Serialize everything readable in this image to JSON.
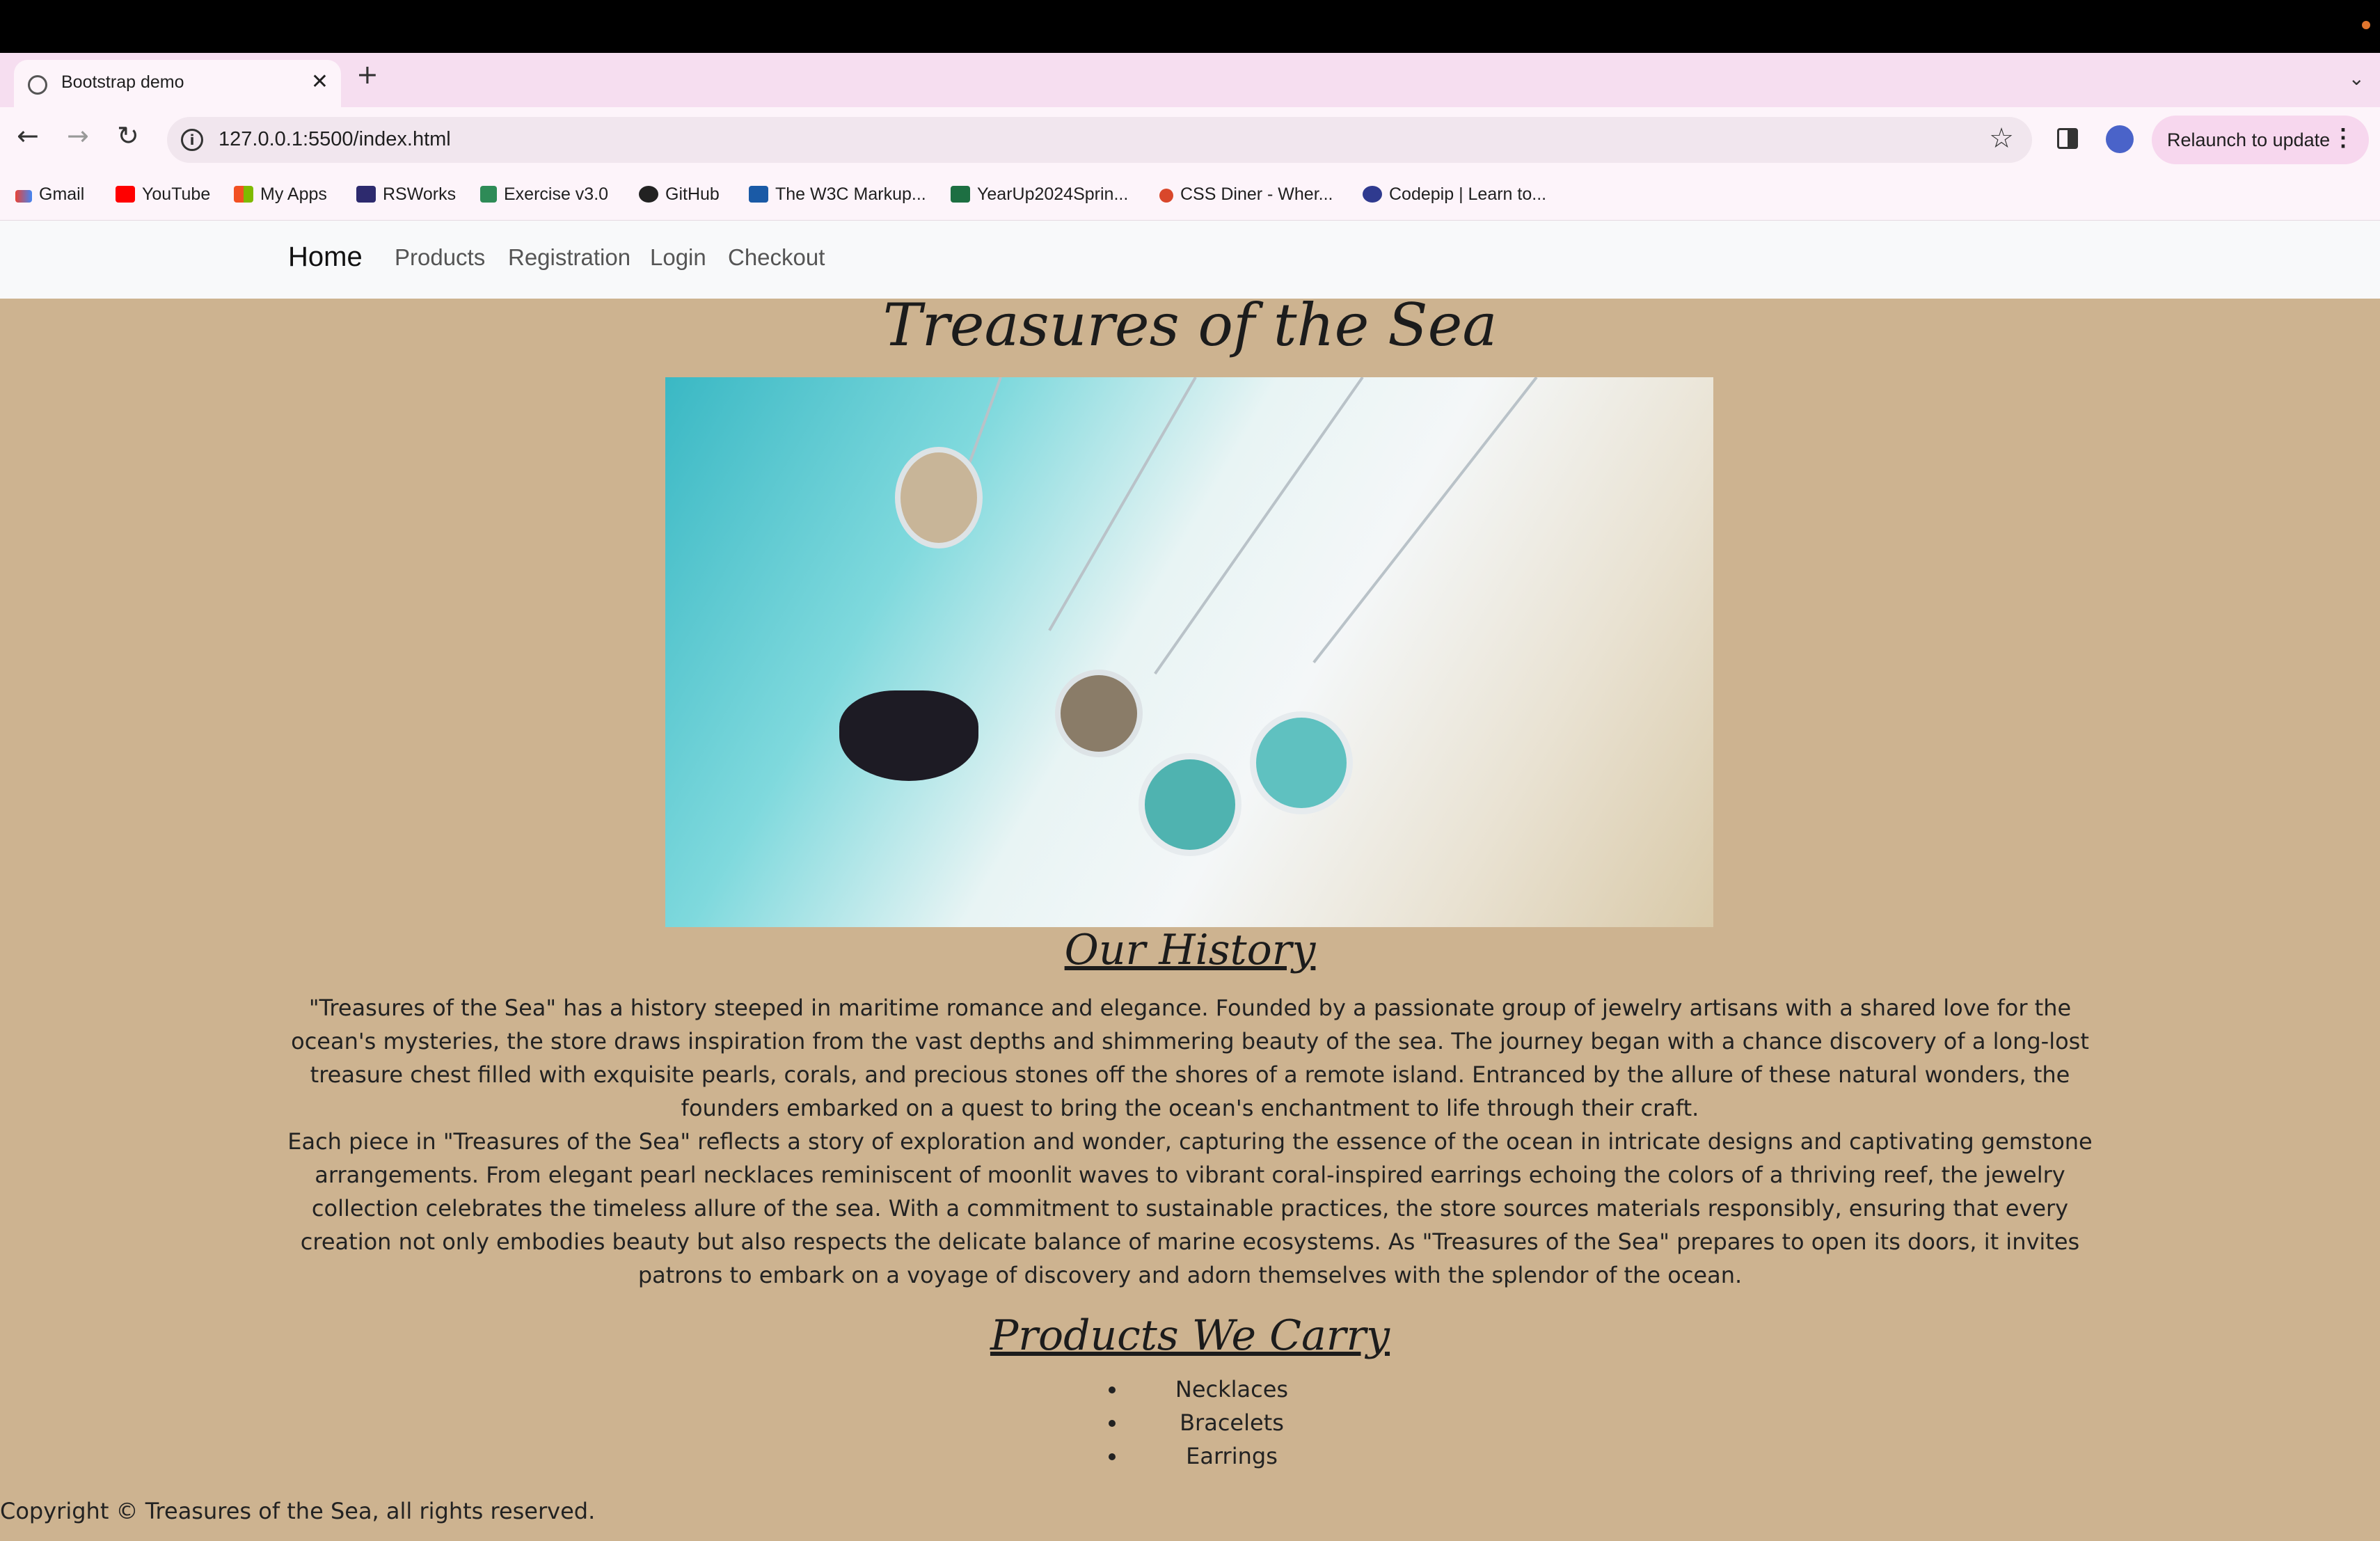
{
  "browser": {
    "tab_title": "Bootstrap demo",
    "url": "127.0.0.1:5500/index.html",
    "relaunch_label": "Relaunch to update",
    "bookmarks": [
      "Gmail",
      "YouTube",
      "My Apps",
      "RSWorks",
      "Exercise v3.0",
      "GitHub",
      "The W3C Markup...",
      "YearUp2024Sprin...",
      "CSS Diner - Wher...",
      "Codepip | Learn to..."
    ]
  },
  "nav": {
    "brand": "Home",
    "links": [
      "Products",
      "Registration",
      "Login",
      "Checkout"
    ]
  },
  "page": {
    "title": "Treasures of the Sea",
    "history_heading": "Our History",
    "history_p1": "\"Treasures of the Sea\" has a history steeped in maritime romance and elegance. Founded by a passionate group of jewelry artisans with a shared love for the ocean's mysteries, the store draws inspiration from the vast depths and shimmering beauty of the sea. The journey began with a chance discovery of a long-lost treasure chest filled with exquisite pearls, corals, and precious stones off the shores of a remote island. Entranced by the allure of these natural wonders, the founders embarked on a quest to bring the ocean's enchantment to life through their craft.",
    "history_p2": "Each piece in \"Treasures of the Sea\" reflects a story of exploration and wonder, capturing the essence of the ocean in intricate designs and captivating gemstone arrangements. From elegant pearl necklaces reminiscent of moonlit waves to vibrant coral-inspired earrings echoing the colors of a thriving reef, the jewelry collection celebrates the timeless allure of the sea. With a commitment to sustainable practices, the store sources materials responsibly, ensuring that every creation not only embodies beauty but also respects the delicate balance of marine ecosystems. As \"Treasures of the Sea\" prepares to open its doors, it invites patrons to embark on a voyage of discovery and adorn themselves with the splendor of the ocean.",
    "products_heading": "Products We Carry",
    "products": [
      "Necklaces",
      "Bracelets",
      "Earrings"
    ],
    "footer": "Copyright © Treasures of the Sea, all rights reserved."
  },
  "colors": {
    "page_bg": "#cdb390",
    "navbar_bg": "#f8f9fa",
    "tabstrip_bg": "#f6def0"
  }
}
